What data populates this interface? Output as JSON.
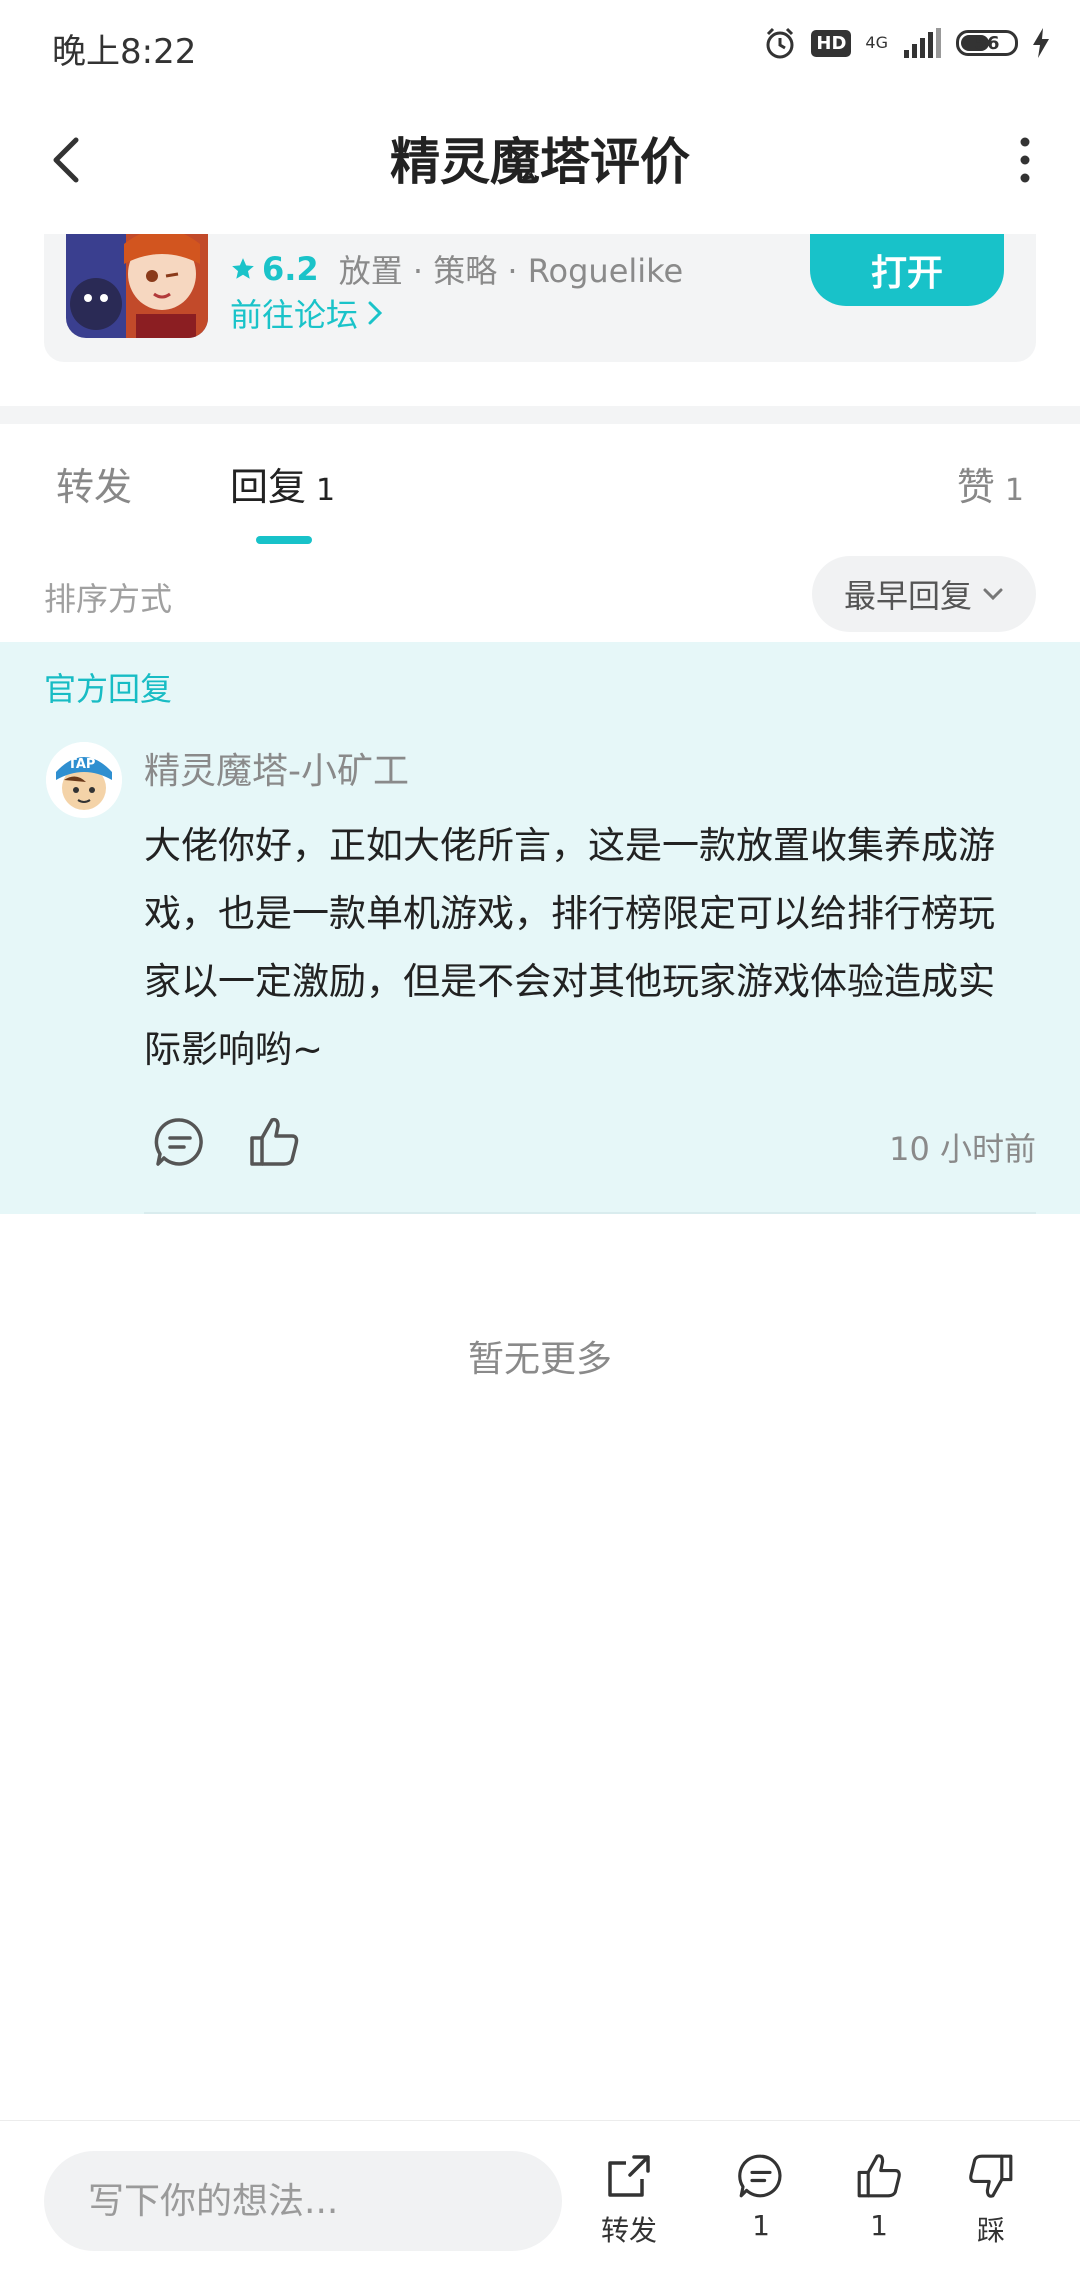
{
  "status_bar": {
    "time": "晚上8:22",
    "hd": "HD",
    "network": "4G",
    "battery": "56"
  },
  "header": {
    "title": "精灵魔塔评价"
  },
  "game_card": {
    "rating": "6.2",
    "genres": "放置 · 策略 · Roguelike",
    "forum_link": "前往论坛",
    "open_button": "打开"
  },
  "tabs": [
    {
      "label": "转发",
      "count": ""
    },
    {
      "label": "回复",
      "count": "1"
    },
    {
      "label": "赞",
      "count": "1"
    }
  ],
  "sort": {
    "label": "排序方式",
    "value": "最早回复"
  },
  "official_reply": {
    "section_label": "官方回复",
    "author": "精灵魔塔-小矿工",
    "text": "大佬你好，正如大佬所言，这是一款放置收集养成游戏，也是一款单机游戏，排行榜限定可以给排行榜玩家以一定激励，但是不会对其他玩家游戏体验造成实际影响哟~",
    "time": "10 小时前"
  },
  "no_more": "暂无更多",
  "bottom_bar": {
    "input_placeholder": "写下你的想法...",
    "share_label": "转发",
    "comment_count": "1",
    "like_count": "1",
    "dislike_label": "踩"
  },
  "colors": {
    "accent": "#18c2c9",
    "reply_bg": "#e6f7f8"
  }
}
